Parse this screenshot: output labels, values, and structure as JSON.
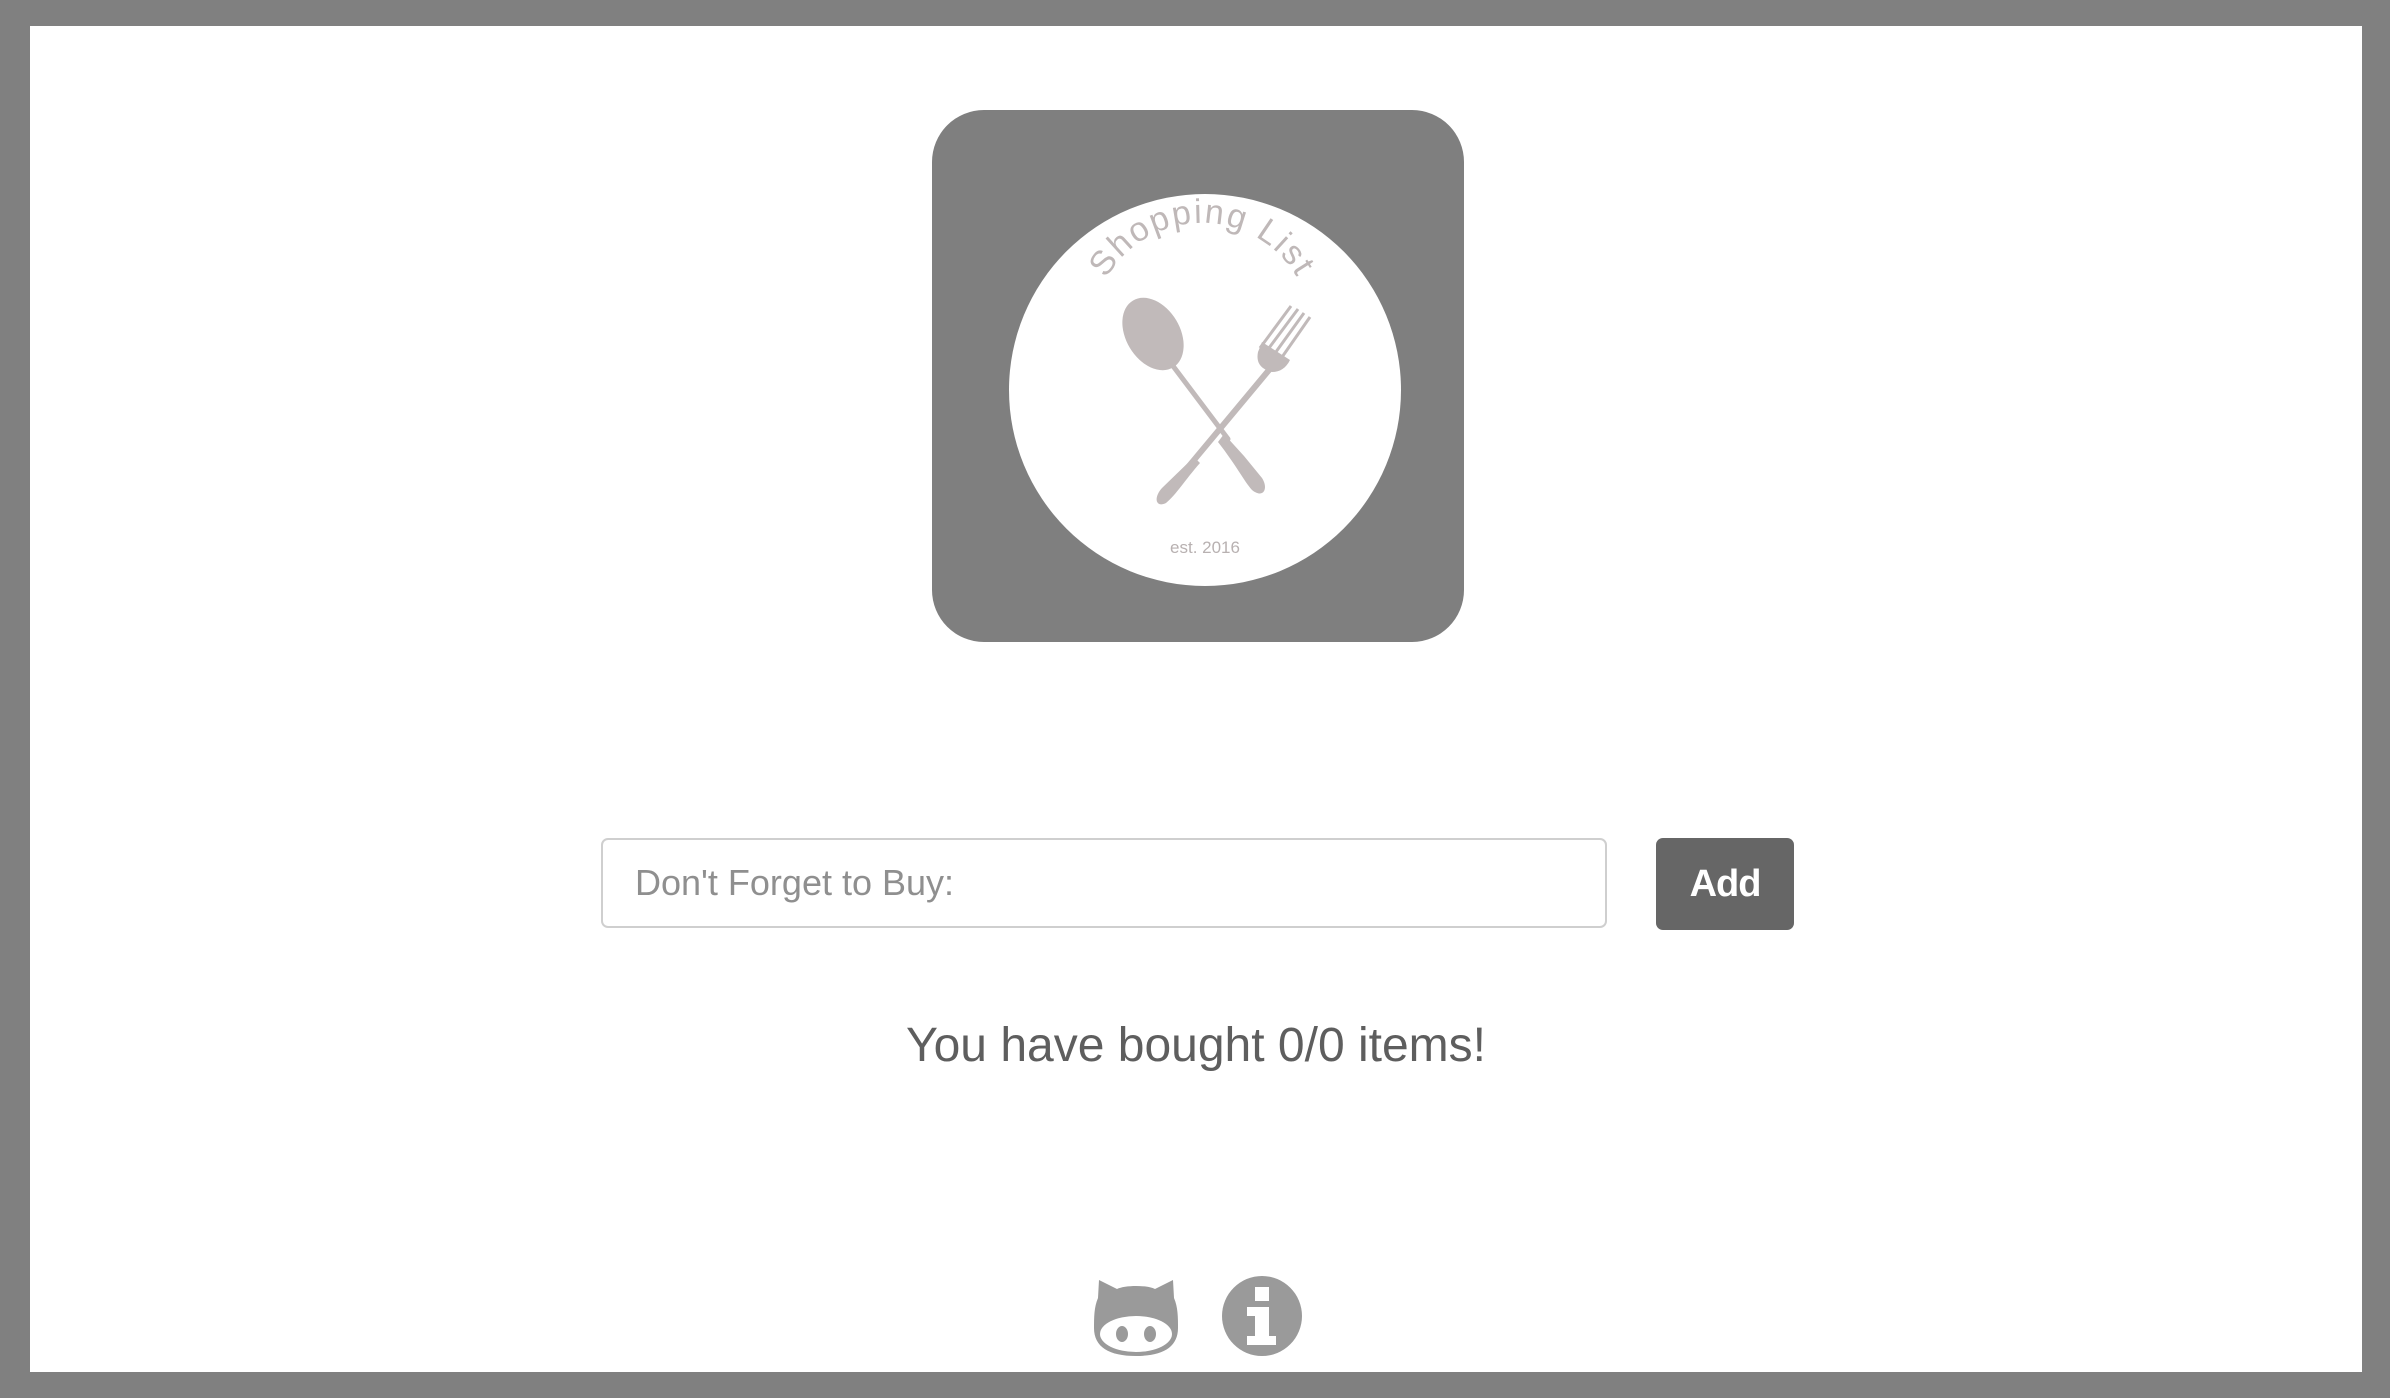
{
  "logo": {
    "title_text": "Shopping List",
    "established_text": "est. 2016",
    "icons": [
      "spoon-icon",
      "fork-icon"
    ]
  },
  "form": {
    "input_placeholder": "Don't Forget to Buy:",
    "input_value": "",
    "add_label": "Add"
  },
  "status": {
    "message": "You have bought 0/0 items!"
  },
  "footer": {
    "icons": [
      "github-icon",
      "info-icon"
    ]
  },
  "colors": {
    "outer_frame": "#808080",
    "logo_tile": "#7f7f7f",
    "logo_text": "#bfb8b8",
    "button_background": "#666666",
    "icon_gray": "#9a9a9a"
  }
}
